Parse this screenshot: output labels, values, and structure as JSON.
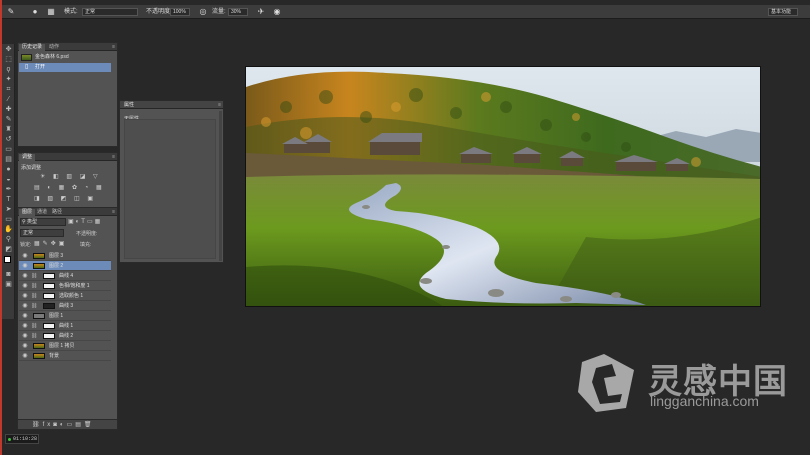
{
  "options_bar": {
    "mode_label": "模式:",
    "mode_value": "正常",
    "opacity_label": "不透明度:",
    "opacity_value": "100%",
    "flow_label": "流量:",
    "flow_value": "30%",
    "workspace_value": "基本功能"
  },
  "history_panel": {
    "tabs": [
      "历史记录",
      "动作"
    ],
    "snapshot_name": "金色森林 6.psd",
    "rows": [
      "打开"
    ]
  },
  "adjustments_panel": {
    "tab": "调整",
    "subtitle": "添加调整",
    "icons_row1": "☀ ◧ ▥ ◪ ▽",
    "icons_row2": "▤ ◐ ▦ ✿ ◔ ▦",
    "icons_row3": "◨ ▧ ◩ ◫ ▣"
  },
  "layers_panel": {
    "tabs": [
      "图层",
      "通道",
      "路径"
    ],
    "kind_label": "类型",
    "blend_mode": "正常",
    "opacity_label": "不透明度:",
    "lock_label": "锁定:",
    "fill_label": "填充:",
    "layers": [
      {
        "name": "图层 3",
        "selected": false,
        "thumb": "photo",
        "indent": 0
      },
      {
        "name": "图层 2",
        "selected": true,
        "thumb": "photo",
        "indent": 0
      },
      {
        "name": "曲线 4",
        "selected": false,
        "thumb": "white",
        "indent": 1
      },
      {
        "name": "色相/饱和度 1",
        "selected": false,
        "thumb": "white",
        "indent": 1
      },
      {
        "name": "选取颜色 1",
        "selected": false,
        "thumb": "white",
        "indent": 1
      },
      {
        "name": "曲线 3",
        "selected": false,
        "thumb": "dark",
        "indent": 1
      },
      {
        "name": "图层 1",
        "selected": false,
        "thumb": "grey",
        "indent": 0
      },
      {
        "name": "曲线 1",
        "selected": false,
        "thumb": "white",
        "indent": 1
      },
      {
        "name": "曲线 2",
        "selected": false,
        "thumb": "white",
        "indent": 1
      },
      {
        "name": "图层 1 拷贝",
        "selected": false,
        "thumb": "photo",
        "indent": 0
      },
      {
        "name": "背景",
        "selected": false,
        "thumb": "photo",
        "indent": 0
      }
    ]
  },
  "properties_panel": {
    "tab": "属性",
    "content": "无属性"
  },
  "status": {
    "timer": "01:10:28"
  },
  "watermark": {
    "cn": "灵感中国",
    "url": "lingganchina.com"
  }
}
